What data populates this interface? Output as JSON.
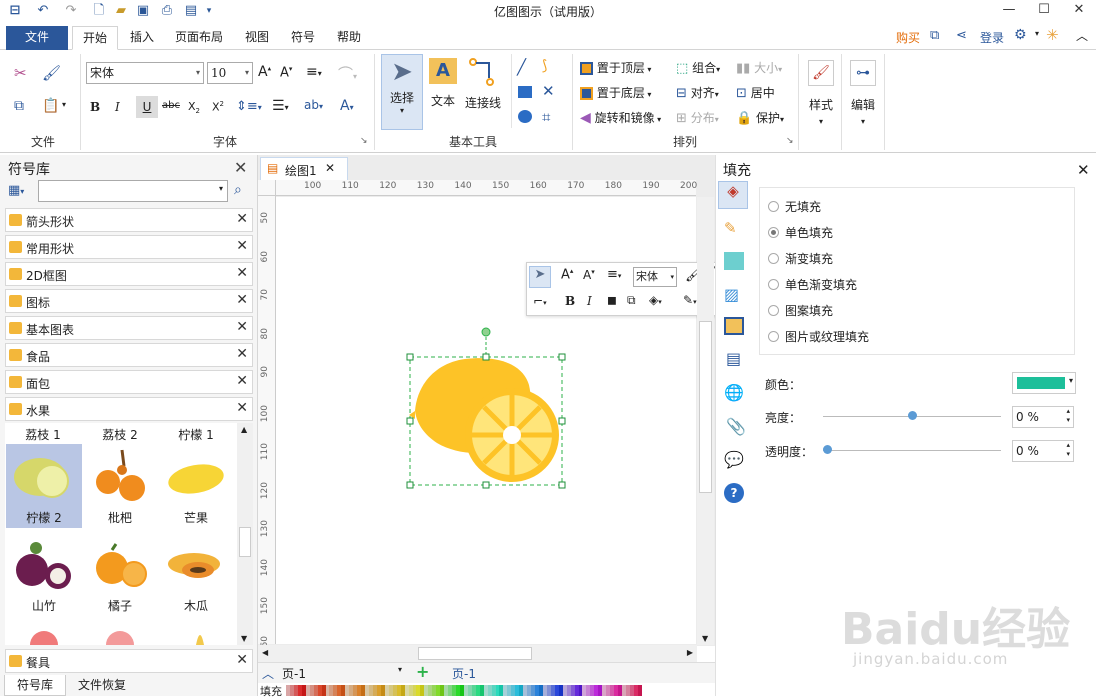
{
  "app": {
    "title": "亿图图示（试用版）"
  },
  "window": {
    "minimize": "—",
    "maximize": "☐",
    "close": "✕"
  },
  "tabs": [
    {
      "label": "文件"
    },
    {
      "label": "开始"
    },
    {
      "label": "插入"
    },
    {
      "label": "页面布局"
    },
    {
      "label": "视图"
    },
    {
      "label": "符号"
    },
    {
      "label": "帮助"
    }
  ],
  "topright": {
    "buy": "购买",
    "login": "登录"
  },
  "ribbon": {
    "groups": {
      "file": "文件",
      "font": "字体",
      "basic_tools": "基本工具",
      "arrange": "排列"
    },
    "font_name": "宋体",
    "font_size": "10",
    "select": "选择",
    "text": "文本",
    "connector": "连接线",
    "bring_front": "置于顶层",
    "send_back": "置于底层",
    "rotate_mirror": "旋转和镜像",
    "group": "组合",
    "align": "对齐",
    "distribute": "分布",
    "size": "大小",
    "center": "居中",
    "protect": "保护",
    "style": "样式",
    "edit": "编辑"
  },
  "symbol_library": {
    "title": "符号库",
    "items": [
      {
        "label": "箭头形状"
      },
      {
        "label": "常用形状"
      },
      {
        "label": "2D框图"
      },
      {
        "label": "图标"
      },
      {
        "label": "基本图表"
      },
      {
        "label": "食品"
      },
      {
        "label": "面包"
      },
      {
        "label": "水果"
      }
    ],
    "fruit_headers": [
      "荔枝 1",
      "荔枝 2",
      "柠檬 1"
    ],
    "fruit_row1": [
      "柠檬 2",
      "枇杷",
      "芒果"
    ],
    "fruit_row2": [
      "山竹",
      "橘子",
      "木瓜"
    ],
    "bottom_item": "餐具",
    "bottom_tabs": [
      "符号库",
      "文件恢复"
    ]
  },
  "document": {
    "tab": "绘图1",
    "ruler_top": [
      "100",
      "110",
      "120",
      "130",
      "140",
      "150",
      "160",
      "170",
      "180",
      "190",
      "200"
    ],
    "ruler_left": [
      "50",
      "60",
      "70",
      "80",
      "90",
      "100",
      "110",
      "120",
      "130",
      "140",
      "150",
      "160"
    ],
    "page_select": "页-1",
    "page_tab": "页-1",
    "fill_label": "填充"
  },
  "floatbar": {
    "font": "宋体"
  },
  "fill_panel": {
    "title": "填充",
    "options": [
      {
        "label": "无填充",
        "selected": false
      },
      {
        "label": "单色填充",
        "selected": true
      },
      {
        "label": "渐变填充",
        "selected": false
      },
      {
        "label": "单色渐变填充",
        "selected": false
      },
      {
        "label": "图案填充",
        "selected": false
      },
      {
        "label": "图片或纹理填充",
        "selected": false
      }
    ],
    "color_label": "颜色：",
    "brightness_label": "亮度：",
    "brightness_value": "0 %",
    "brightness_level": 0.5,
    "transparency_label": "透明度：",
    "transparency_value": "0 %",
    "transparency_level": 0,
    "color": "#1dbf9a"
  },
  "watermark": {
    "text": "Baidu经验",
    "url": "jingyan.baidu.com"
  },
  "colors": {
    "accent": "#2b579a",
    "buy": "#e36c09",
    "lemon": "#ffc627",
    "lemon_light": "#ffe38a"
  }
}
